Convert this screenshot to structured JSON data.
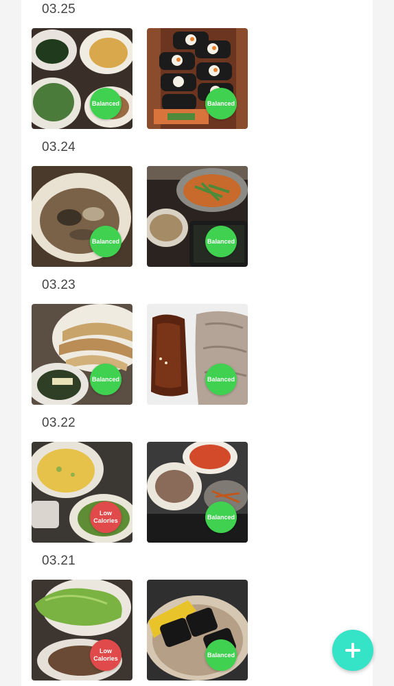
{
  "days": [
    {
      "date": "03.25",
      "meals": [
        {
          "photo": "banchan-plates-photo",
          "badge": "Balanced",
          "color": "#3fd14f"
        },
        {
          "photo": "kimbap-stack-photo",
          "badge": "Balanced",
          "color": "#3fd14f"
        }
      ]
    },
    {
      "date": "03.24",
      "meals": [
        {
          "photo": "soup-bowl-photo",
          "badge": "Balanced",
          "color": "#3fd14f"
        },
        {
          "photo": "side-dishes-containers-photo",
          "badge": "Balanced",
          "color": "#3fd14f"
        }
      ]
    },
    {
      "date": "03.23",
      "meals": [
        {
          "photo": "grilled-fish-photo",
          "badge": "Balanced",
          "color": "#3fd14f"
        },
        {
          "photo": "grilled-meat-photo",
          "badge": "Balanced",
          "color": "#3fd14f"
        }
      ]
    },
    {
      "date": "03.22",
      "meals": [
        {
          "photo": "egg-pancake-salad-photo",
          "badge": "Low\nCalories",
          "color": "#e04a4a"
        },
        {
          "photo": "kimchi-meat-seaweed-photo",
          "badge": "Balanced",
          "color": "#3fd14f"
        }
      ]
    },
    {
      "date": "03.21",
      "meals": [
        {
          "photo": "lettuce-wraps-photo",
          "badge": "Low\nCalories",
          "color": "#e04a4a"
        },
        {
          "photo": "kimbap-plate-photo",
          "badge": "Balanced",
          "color": "#3fd14f"
        }
      ]
    }
  ],
  "fab": {
    "icon": "plus-icon",
    "color": "#35e3c7"
  }
}
